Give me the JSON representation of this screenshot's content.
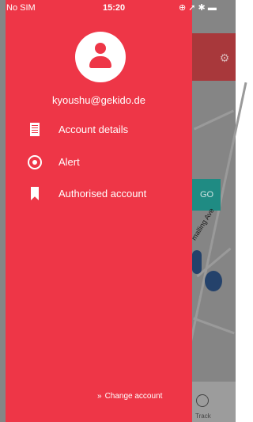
{
  "status_bar": {
    "carrier": "No SIM",
    "time": "15:20",
    "right_icons": "⊕ ➚ ✱ ▬"
  },
  "drawer": {
    "email": "kyoushu@gekido.de",
    "menu": [
      {
        "label": "Account details",
        "icon": "document-icon"
      },
      {
        "label": "Alert",
        "icon": "alert-icon"
      },
      {
        "label": "Authorised account",
        "icon": "bookmark-icon"
      }
    ],
    "change_account": "Change account",
    "change_chevron": "»"
  },
  "background": {
    "go_label": "GO",
    "street_label": "malling Ave",
    "track_label": "Track",
    "header_icon": "⚙"
  },
  "colors": {
    "drawer": "#ee3647",
    "go": "#1f8b83"
  }
}
